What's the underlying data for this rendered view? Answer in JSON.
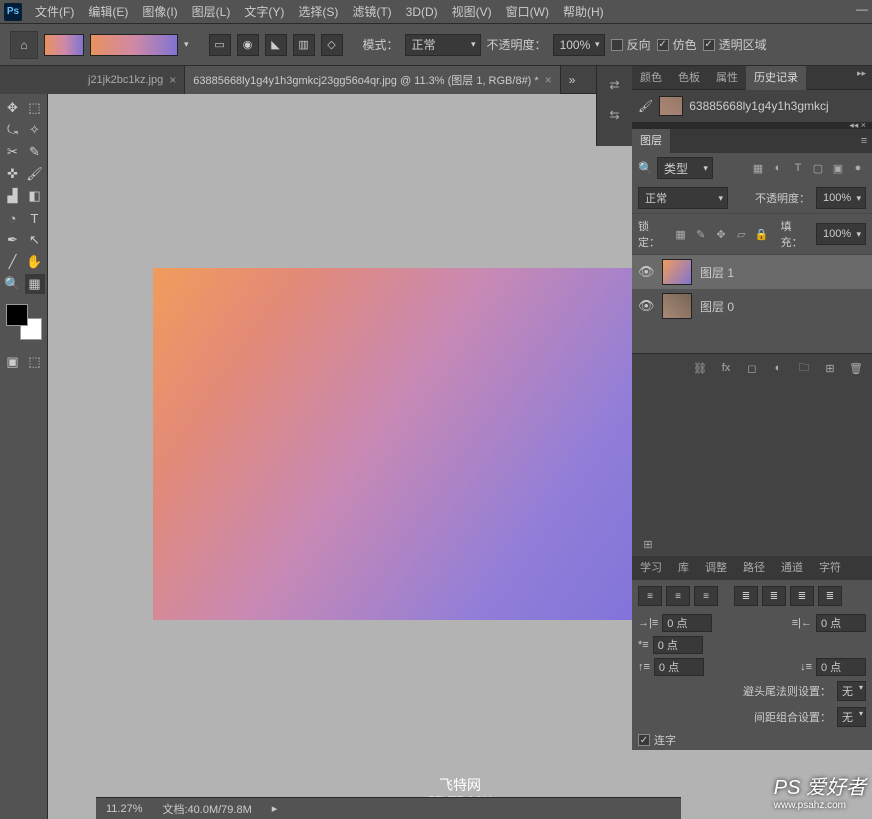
{
  "menu": [
    "文件(F)",
    "编辑(E)",
    "图像(I)",
    "图层(L)",
    "文字(Y)",
    "选择(S)",
    "滤镜(T)",
    "3D(D)",
    "视图(V)",
    "窗口(W)",
    "帮助(H)"
  ],
  "options": {
    "mode_label": "模式：",
    "mode_value": "正常",
    "opacity_label": "不透明度：",
    "opacity_value": "100%",
    "reverse": "反向",
    "dither": "仿色",
    "transparency": "透明区域"
  },
  "tabs": {
    "inactive": "j21jk2bc1kz.jpg",
    "active": "63885668ly1g4y1h3gmkcj23gg56o4qr.jpg @ 11.3% (图层 1, RGB/8#) *"
  },
  "history": {
    "tabs": [
      "颜色",
      "色板",
      "属性",
      "历史记录"
    ],
    "file": "63885668ly1g4y1h3gmkcj"
  },
  "layers": {
    "title": "图层",
    "kind_label": "类型",
    "blend": "正常",
    "opacity_label": "不透明度：",
    "opacity_value": "100%",
    "lock_label": "锁定：",
    "fill_label": "填充：",
    "fill_value": "100%",
    "items": [
      {
        "name": "图层 1"
      },
      {
        "name": "图层 0"
      }
    ]
  },
  "paragraph": {
    "tabs": [
      "学习",
      "库",
      "调整",
      "路径",
      "通道",
      "字符"
    ],
    "zero": "0 点",
    "rule1_label": "避头尾法则设置：",
    "rule1_value": "无",
    "rule2_label": "间距组合设置：",
    "rule2_value": "无",
    "hyphen": "连字"
  },
  "status": {
    "zoom": "11.27%",
    "doc": "文档:40.0M/79.8M"
  },
  "watermark": {
    "line1": "飞特网",
    "line2": "FEVTE.COM"
  },
  "corner": {
    "brand": "PS 爱好者",
    "url": "www.psahz.com"
  }
}
